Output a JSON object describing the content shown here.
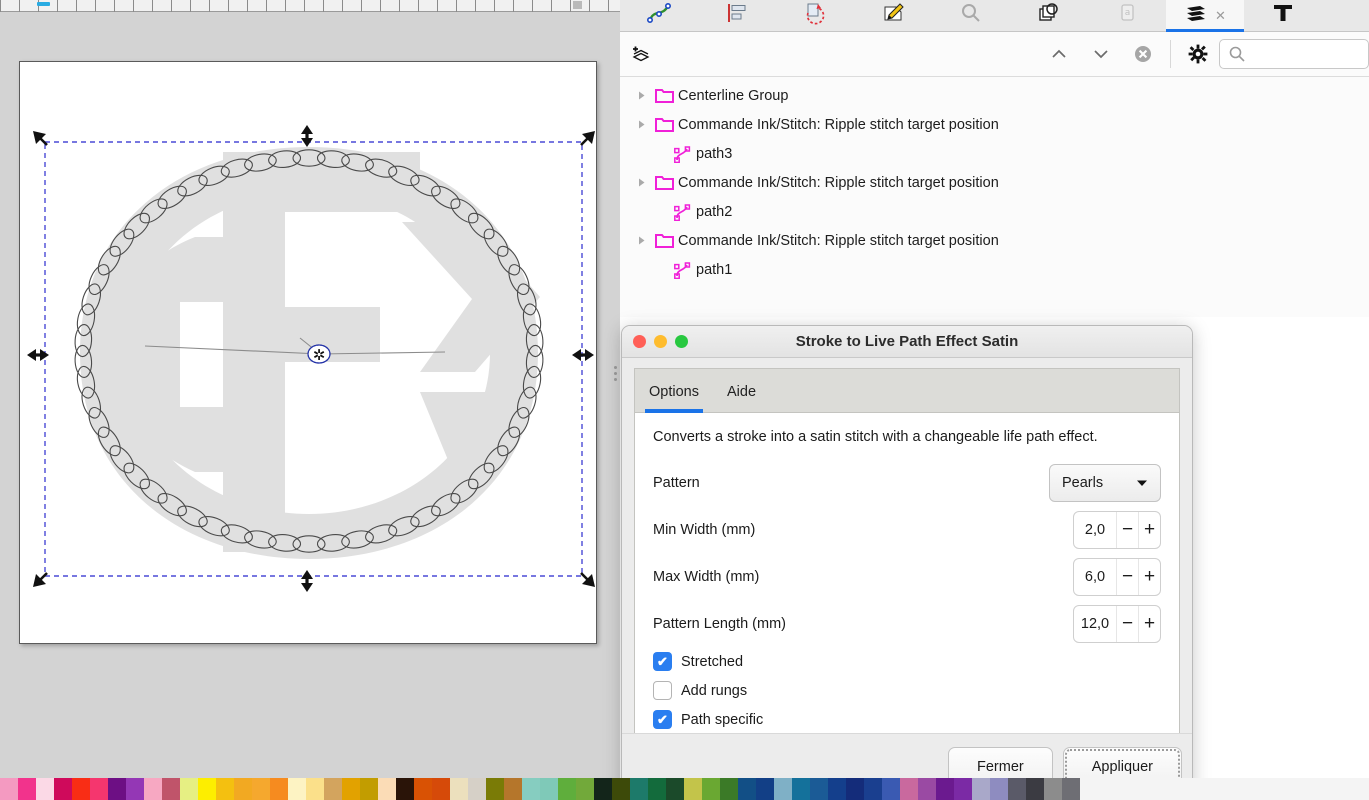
{
  "app": {
    "canvas": {
      "page_label": "drawing-page",
      "artwork_name": "oval-pearls-satin-path"
    },
    "palette": {
      "name": "color-palette",
      "swatches": [
        "#f49ac1",
        "#f2338c",
        "#fbd9e6",
        "#cf0a5b",
        "#f92d15",
        "#f5366e",
        "#6d0f84",
        "#9437b5",
        "#f7a8c2",
        "#c0546a",
        "#e6ef83",
        "#fdee00",
        "#f4c010",
        "#f2a922",
        "#f5a82e",
        "#f68b1f",
        "#fdf3c3",
        "#fbe08a",
        "#d3a45e",
        "#e2a200",
        "#c29d00",
        "#fbdcb6",
        "#2a1408",
        "#d95204",
        "#d64a09",
        "#ece0bd",
        "#d6d0c7",
        "#7a7b06",
        "#b5762b",
        "#86cdc0",
        "#7fc9b8",
        "#5fae3c",
        "#72a93a",
        "#13251a",
        "#3d4a09",
        "#1d7a6a",
        "#136b3c",
        "#1b4a2a",
        "#c3c44a",
        "#6aa832",
        "#3b7a27",
        "#124f86",
        "#123f86",
        "#7fb0c6",
        "#14719b",
        "#1b5b96",
        "#143f8c",
        "#142c7a",
        "#1a3f8f",
        "#3a5ab2",
        "#c9699e",
        "#9a4aa3",
        "#6b1a8f",
        "#7b2aa5",
        "#a9a8c9",
        "#8e8cc0",
        "#5a5a68",
        "#3b3b42",
        "#8c8c8c",
        "#6e6e74"
      ]
    },
    "ruler": {
      "name": "horizontal-ruler"
    }
  },
  "dock": {
    "tabs": [
      {
        "id": "tab-xml-editor",
        "icon": "nodes-path-icon",
        "label": ""
      },
      {
        "id": "tab-align",
        "icon": "align-distribute-icon",
        "label": ""
      },
      {
        "id": "tab-transform",
        "icon": "transform-rotate-icon",
        "label": ""
      },
      {
        "id": "tab-pen-tool",
        "icon": "pen-edit-icon",
        "label": ""
      },
      {
        "id": "tab-find",
        "icon": "search-magnifier-icon",
        "label": ""
      },
      {
        "id": "tab-objects",
        "icon": "objects-stack-icon",
        "label": ""
      },
      {
        "id": "tab-text-properties",
        "icon": "text-box-icon",
        "label": ""
      },
      {
        "id": "tab-layers",
        "icon": "layers-icon",
        "label": "",
        "active": true,
        "closable": true
      },
      {
        "id": "tab-text",
        "icon": "text-tool-icon",
        "label": ""
      }
    ],
    "toolbar": {
      "add_layer": "add-layer-icon",
      "raise_layer": "chevron-up-icon",
      "lower_layer": "chevron-down-icon",
      "delete_layer": "delete-circle-icon",
      "settings": "gear-icon",
      "search_placeholder": "",
      "search_value": ""
    },
    "layers": [
      {
        "label": "Centerline Group",
        "type": "group",
        "expandable": true,
        "indent": 0
      },
      {
        "label": "Commande Ink/Stitch: Ripple stitch target position",
        "type": "group",
        "expandable": true,
        "indent": 0
      },
      {
        "label": "path3",
        "type": "path",
        "expandable": false,
        "indent": 1
      },
      {
        "label": "Commande Ink/Stitch: Ripple stitch target position",
        "type": "group",
        "expandable": true,
        "indent": 0
      },
      {
        "label": "path2",
        "type": "path",
        "expandable": false,
        "indent": 1
      },
      {
        "label": "Commande Ink/Stitch: Ripple stitch target position",
        "type": "group",
        "expandable": true,
        "indent": 0
      },
      {
        "label": "path1",
        "type": "path",
        "expandable": false,
        "indent": 1
      }
    ]
  },
  "dialog": {
    "title": "Stroke to Live Path Effect Satin",
    "window_buttons": {
      "close": "#ff5f57",
      "minimize": "#febc2e",
      "zoom": "#28c840"
    },
    "tabs": [
      {
        "label": "Options",
        "active": true
      },
      {
        "label": "Aide",
        "active": false
      }
    ],
    "description": "Converts a stroke into a satin stitch with a changeable life path effect.",
    "fields": {
      "pattern": {
        "label": "Pattern",
        "value": "Pearls"
      },
      "min_width": {
        "label": "Min Width (mm)",
        "value": "2,0"
      },
      "max_width": {
        "label": "Max Width (mm)",
        "value": "6,0"
      },
      "pattern_length": {
        "label": "Pattern Length (mm)",
        "value": "12,0"
      }
    },
    "checkboxes": [
      {
        "label": "Stretched",
        "checked": true
      },
      {
        "label": "Add rungs",
        "checked": false
      },
      {
        "label": "Path specific",
        "checked": true
      }
    ],
    "buttons": {
      "close": "Fermer",
      "apply": "Appliquer"
    },
    "accent_color": "#1a73e8",
    "checkbox_color": "#2a7ef0"
  }
}
